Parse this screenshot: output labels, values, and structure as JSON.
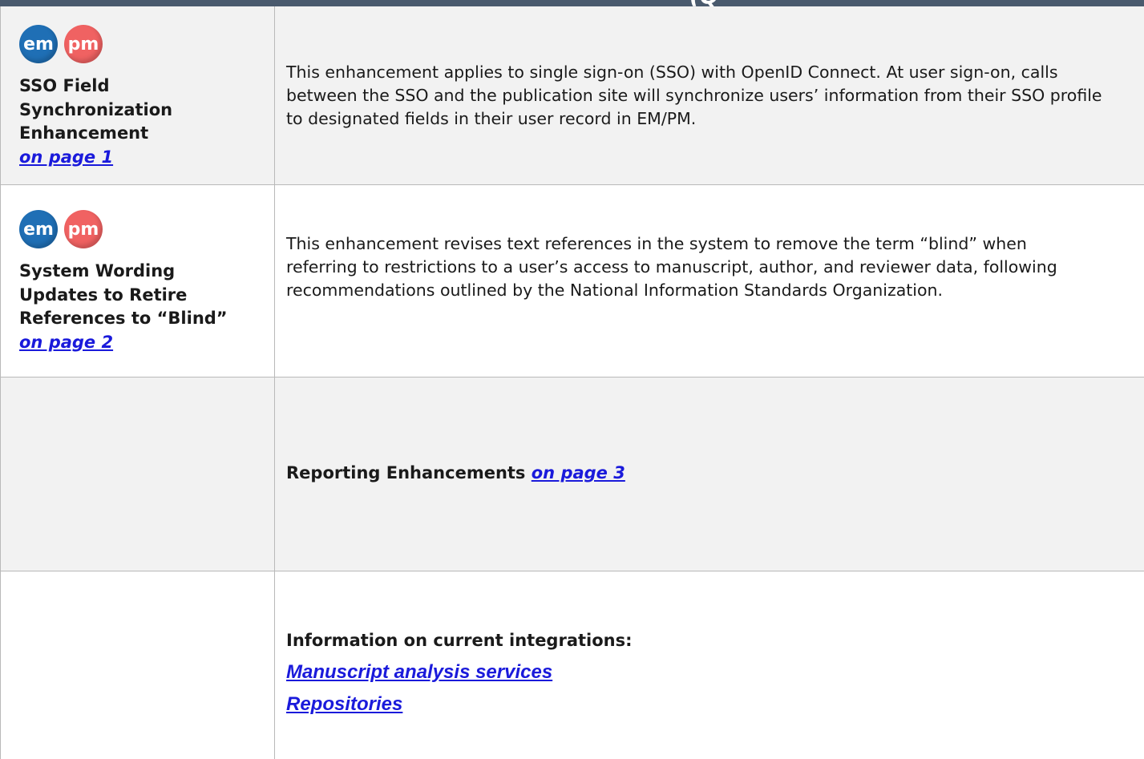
{
  "header": {
    "title_fragment": "(Q",
    "background": "#4a5a6e"
  },
  "colors": {
    "em_badge": "#1f6fb5",
    "pm_badge": "#f06262",
    "link": "#1a1adb",
    "row_shading": "#f2f2f2"
  },
  "rows": [
    {
      "badges": [
        "em",
        "pm"
      ],
      "title": "SSO Field Synchronization Enhancement",
      "link": "on page 1",
      "description": "This enhancement applies to single sign-on (SSO) with OpenID Connect. At user sign-on, calls between the SSO and the publication site will synchronize users’ information from their SSO profile to designated fields in their user record in EM/PM."
    },
    {
      "badges": [
        "em",
        "pm"
      ],
      "title": "System Wording Updates to Retire References to “Blind”",
      "link": "on page 2",
      "description": "This enhancement revises text references in the system to remove the term “blind” when referring to restrictions to a user’s access to manuscript, author, and reviewer data, following recommendations outlined by the National Information Standards Organization."
    },
    {
      "label": "Reporting Enhancements",
      "link": "on page 3"
    },
    {
      "heading": "Information on current integrations:",
      "links": [
        "Manuscript analysis services",
        "Repositories"
      ]
    }
  ]
}
